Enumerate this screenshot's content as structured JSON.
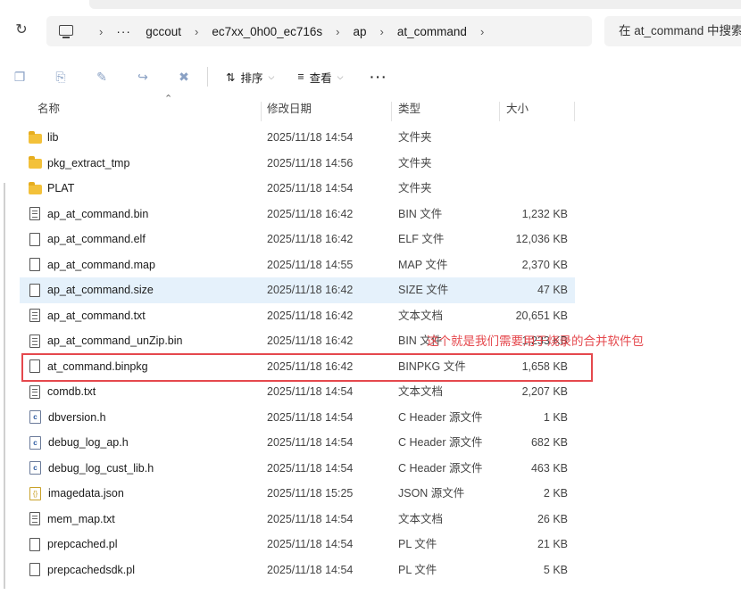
{
  "address_bar": {
    "breadcrumbs": [
      "···",
      "gccout",
      "ec7xx_0h00_ec716s",
      "ap",
      "at_command"
    ],
    "search_placeholder": "在 at_command 中搜索"
  },
  "toolbar": {
    "sort_label": "排序",
    "view_label": "查看",
    "more_label": "···"
  },
  "columns": {
    "name": "名称",
    "date": "修改日期",
    "type": "类型",
    "size": "大小"
  },
  "files": [
    {
      "name": "lib",
      "date": "2025/11/18 14:54",
      "type": "文件夹",
      "size": "",
      "icon": "folder-icon"
    },
    {
      "name": "pkg_extract_tmp",
      "date": "2025/11/18 14:56",
      "type": "文件夹",
      "size": "",
      "icon": "folder-icon"
    },
    {
      "name": "PLAT",
      "date": "2025/11/18 14:54",
      "type": "文件夹",
      "size": "",
      "icon": "folder-icon"
    },
    {
      "name": "ap_at_command.bin",
      "date": "2025/11/18 16:42",
      "type": "BIN 文件",
      "size": "1,232 KB",
      "icon": "text-file-icon"
    },
    {
      "name": "ap_at_command.elf",
      "date": "2025/11/18 16:42",
      "type": "ELF 文件",
      "size": "12,036 KB",
      "icon": "file-icon"
    },
    {
      "name": "ap_at_command.map",
      "date": "2025/11/18 14:55",
      "type": "MAP 文件",
      "size": "2,370 KB",
      "icon": "file-icon"
    },
    {
      "name": "ap_at_command.size",
      "date": "2025/11/18 16:42",
      "type": "SIZE 文件",
      "size": "47 KB",
      "icon": "file-icon"
    },
    {
      "name": "ap_at_command.txt",
      "date": "2025/11/18 16:42",
      "type": "文本文档",
      "size": "20,651 KB",
      "icon": "text-file-icon"
    },
    {
      "name": "ap_at_command_unZip.bin",
      "date": "2025/11/18 16:42",
      "type": "BIN 文件",
      "size": "1,233 KB",
      "icon": "text-file-icon"
    },
    {
      "name": "at_command.binpkg",
      "date": "2025/11/18 16:42",
      "type": "BINPKG 文件",
      "size": "1,658 KB",
      "icon": "file-icon"
    },
    {
      "name": "comdb.txt",
      "date": "2025/11/18 14:54",
      "type": "文本文档",
      "size": "2,207 KB",
      "icon": "text-file-icon"
    },
    {
      "name": "dbversion.h",
      "date": "2025/11/18 14:54",
      "type": "C Header 源文件",
      "size": "1 KB",
      "icon": "c-header-icon"
    },
    {
      "name": "debug_log_ap.h",
      "date": "2025/11/18 14:54",
      "type": "C Header 源文件",
      "size": "682 KB",
      "icon": "c-header-icon"
    },
    {
      "name": "debug_log_cust_lib.h",
      "date": "2025/11/18 14:54",
      "type": "C Header 源文件",
      "size": "463 KB",
      "icon": "c-header-icon"
    },
    {
      "name": "imagedata.json",
      "date": "2025/11/18 15:25",
      "type": "JSON 源文件",
      "size": "2 KB",
      "icon": "json-file-icon"
    },
    {
      "name": "mem_map.txt",
      "date": "2025/11/18 14:54",
      "type": "文本文档",
      "size": "26 KB",
      "icon": "text-file-icon"
    },
    {
      "name": "prepcached.pl",
      "date": "2025/11/18 14:54",
      "type": "PL 文件",
      "size": "21 KB",
      "icon": "file-icon"
    },
    {
      "name": "prepcachedsdk.pl",
      "date": "2025/11/18 14:54",
      "type": "PL 文件",
      "size": "5 KB",
      "icon": "file-icon"
    }
  ],
  "selected_row": "ap_at_command.size",
  "annotation": {
    "text": "这个就是我们需要用于烧录的合并软件包",
    "color": "#e5484d"
  }
}
